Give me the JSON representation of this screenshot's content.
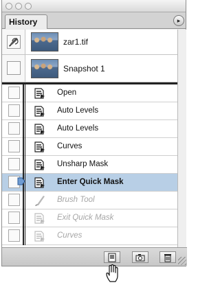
{
  "window": {
    "tab_label": "History",
    "menu_glyph": "▸"
  },
  "snapshots": [
    {
      "label": "zar1.tif",
      "has_brush": true
    },
    {
      "label": "Snapshot 1",
      "has_brush": false
    }
  ],
  "history_states": [
    {
      "label": "Open",
      "state": "done",
      "icon": "history-state-icon"
    },
    {
      "label": "Auto Levels",
      "state": "done",
      "icon": "history-state-icon"
    },
    {
      "label": "Auto Levels",
      "state": "done",
      "icon": "history-state-icon"
    },
    {
      "label": "Curves",
      "state": "done",
      "icon": "history-state-icon"
    },
    {
      "label": "Unsharp Mask",
      "state": "done",
      "icon": "history-state-icon"
    },
    {
      "label": "Enter Quick Mask",
      "state": "current",
      "icon": "history-state-icon"
    },
    {
      "label": "Brush Tool",
      "state": "undone",
      "icon": "brush-icon"
    },
    {
      "label": "Exit Quick Mask",
      "state": "undone",
      "icon": "history-state-icon"
    },
    {
      "label": "Curves",
      "state": "undone",
      "icon": "history-state-icon"
    }
  ],
  "bottom_buttons": [
    {
      "name": "new-document-from-state-button",
      "icon": "new-document-icon"
    },
    {
      "name": "new-snapshot-button",
      "icon": "camera-icon"
    },
    {
      "name": "delete-state-button",
      "icon": "trash-icon"
    }
  ],
  "colors": {
    "selection": "#b8cfe6",
    "undone_text": "#a6a6a6"
  }
}
